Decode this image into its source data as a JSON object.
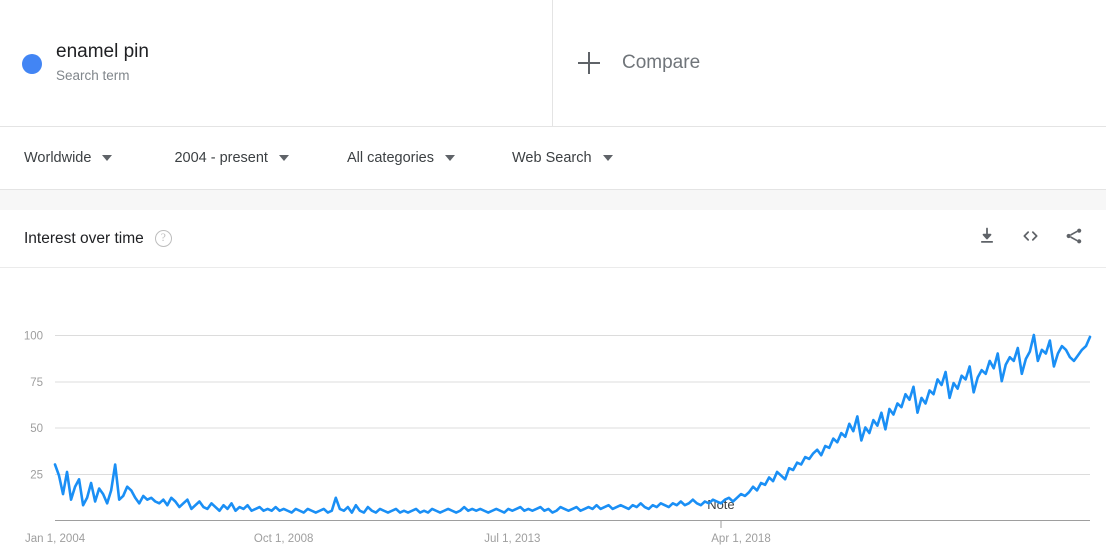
{
  "search_term": {
    "title": "enamel pin",
    "subtitle": "Search term",
    "dot_color": "#4285f4"
  },
  "compare": {
    "label": "Compare",
    "icon": "plus-icon"
  },
  "filters": [
    {
      "label": "Worldwide",
      "name": "location"
    },
    {
      "label": "2004 - present",
      "name": "time-range"
    },
    {
      "label": "All categories",
      "name": "category"
    },
    {
      "label": "Web Search",
      "name": "search-type"
    }
  ],
  "card": {
    "title": "Interest over time",
    "help_icon": "?",
    "actions": [
      {
        "name": "download-icon",
        "label": "Download"
      },
      {
        "name": "embed-icon",
        "label": "Embed"
      },
      {
        "name": "share-icon",
        "label": "Share"
      }
    ]
  },
  "chart_data": {
    "type": "line",
    "title": "Interest over time",
    "xlabel": "",
    "ylabel": "",
    "ylim": [
      0,
      100
    ],
    "yticks": [
      25,
      50,
      75,
      100
    ],
    "grid": true,
    "legend_position": "top",
    "line_color": "#1a8ff5",
    "xticks": [
      "Jan 1, 2004",
      "Oct 1, 2008",
      "Jul 1, 2013",
      "Apr 1, 2018"
    ],
    "xtick_positions": [
      0,
      57,
      114,
      171
    ],
    "annotations": [
      {
        "label": "Note",
        "x_index": 166
      }
    ],
    "series": [
      {
        "name": "enamel pin",
        "values": [
          30,
          24,
          14,
          26,
          11,
          18,
          22,
          8,
          12,
          20,
          10,
          17,
          14,
          9,
          16,
          30,
          11,
          13,
          18,
          16,
          12,
          9,
          13,
          11,
          12,
          10,
          9,
          11,
          8,
          12,
          10,
          7,
          9,
          11,
          6,
          8,
          10,
          7,
          6,
          9,
          7,
          5,
          8,
          6,
          9,
          5,
          7,
          6,
          8,
          5,
          6,
          7,
          5,
          6,
          5,
          7,
          5,
          6,
          5,
          4,
          6,
          5,
          4,
          6,
          5,
          4,
          5,
          6,
          4,
          5,
          12,
          6,
          5,
          7,
          4,
          8,
          5,
          4,
          7,
          5,
          4,
          6,
          5,
          4,
          5,
          6,
          4,
          5,
          4,
          5,
          6,
          4,
          5,
          4,
          6,
          5,
          4,
          5,
          6,
          5,
          4,
          5,
          7,
          5,
          6,
          5,
          6,
          5,
          4,
          5,
          6,
          5,
          4,
          6,
          5,
          6,
          7,
          5,
          6,
          5,
          6,
          7,
          5,
          6,
          4,
          5,
          7,
          6,
          5,
          6,
          7,
          5,
          6,
          7,
          6,
          8,
          6,
          7,
          8,
          6,
          7,
          8,
          7,
          6,
          8,
          7,
          9,
          7,
          6,
          8,
          7,
          9,
          8,
          7,
          9,
          8,
          10,
          8,
          9,
          11,
          9,
          8,
          10,
          9,
          11,
          10,
          9,
          11,
          12,
          10,
          12,
          14,
          13,
          15,
          18,
          16,
          20,
          19,
          23,
          21,
          26,
          24,
          22,
          28,
          27,
          31,
          30,
          34,
          33,
          36,
          38,
          35,
          40,
          39,
          44,
          42,
          47,
          45,
          52,
          48,
          56,
          43,
          50,
          47,
          54,
          51,
          58,
          49,
          60,
          57,
          63,
          61,
          68,
          65,
          72,
          58,
          66,
          63,
          70,
          68,
          76,
          73,
          80,
          66,
          74,
          71,
          78,
          76,
          83,
          69,
          77,
          81,
          79,
          86,
          82,
          90,
          75,
          84,
          88,
          86,
          93,
          79,
          87,
          91,
          100,
          86,
          92,
          90,
          97,
          83,
          90,
          94,
          92,
          88,
          86,
          89,
          92,
          94,
          99
        ]
      }
    ]
  }
}
